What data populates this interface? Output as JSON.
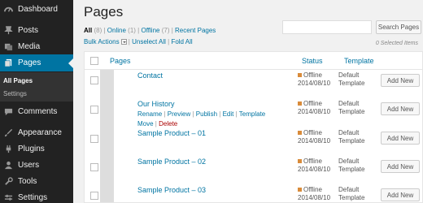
{
  "sidebar": {
    "items": [
      {
        "label": "Dashboard",
        "icon": "dashboard-icon"
      },
      {
        "label": "Posts",
        "icon": "pin-icon"
      },
      {
        "label": "Media",
        "icon": "media-icon"
      },
      {
        "label": "Pages",
        "icon": "pages-icon"
      },
      {
        "label": "Comments",
        "icon": "comment-icon"
      },
      {
        "label": "Appearance",
        "icon": "brush-icon"
      },
      {
        "label": "Plugins",
        "icon": "plug-icon"
      },
      {
        "label": "Users",
        "icon": "users-icon"
      },
      {
        "label": "Tools",
        "icon": "wrench-icon"
      },
      {
        "label": "Settings",
        "icon": "settings-icon"
      }
    ],
    "submenu": [
      "All Pages",
      "Settings"
    ]
  },
  "main": {
    "title": "Pages",
    "views": {
      "all": "All",
      "all_count": "(8)",
      "online": "Online",
      "online_count": "(1)",
      "offline": "Offline",
      "offline_count": "(7)",
      "recent": "Recent Pages"
    },
    "actions": {
      "bulk": "Bulk Actions",
      "unselect": "Unselect All",
      "fold": "Fold All"
    },
    "search_button": "Search Pages",
    "selected_info": "0 Selected Items"
  },
  "table": {
    "headers": {
      "pages": "Pages",
      "status": "Status",
      "template": "Template"
    },
    "rows": [
      {
        "title": "Contact",
        "status": "Offline",
        "date": "2014/08/10",
        "template_line1": "Default",
        "template_line2": "Template",
        "add": "Add New"
      },
      {
        "title": "Our History",
        "status": "Offline",
        "date": "2014/08/10",
        "template_line1": "Default",
        "template_line2": "Template",
        "add": "Add New"
      },
      {
        "title": "Sample Product – 01",
        "status": "Offline",
        "date": "2014/08/10",
        "template_line1": "Default",
        "template_line2": "Template",
        "add": "Add New"
      },
      {
        "title": "Sample Product – 02",
        "status": "Offline",
        "date": "2014/08/10",
        "template_line1": "Default",
        "template_line2": "Template",
        "add": "Add New"
      },
      {
        "title": "Sample Product – 03",
        "status": "Offline",
        "date": "2014/08/10",
        "template_line1": "Default",
        "template_line2": "Template",
        "add": "Add New"
      }
    ],
    "row_actions": [
      "Rename",
      "Preview",
      "Publish",
      "Edit",
      "Template",
      "Move",
      "Delete"
    ]
  },
  "colors": {
    "accent": "#0074a2",
    "sidebar": "#222222",
    "status_dot": "#d98b3a"
  }
}
